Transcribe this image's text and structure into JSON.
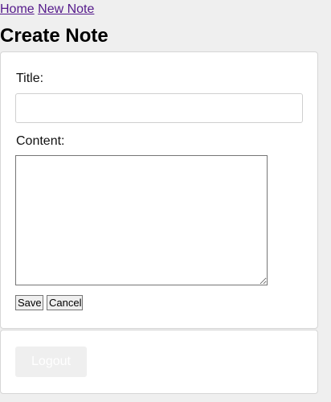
{
  "nav": {
    "home_label": "Home",
    "new_note_label": "New Note"
  },
  "page": {
    "title": "Create Note"
  },
  "form": {
    "title_label": "Title:",
    "title_value": "",
    "content_label": "Content:",
    "content_value": "",
    "save_label": "Save",
    "cancel_label": "Cancel"
  },
  "account": {
    "logout_label": "Logout"
  }
}
